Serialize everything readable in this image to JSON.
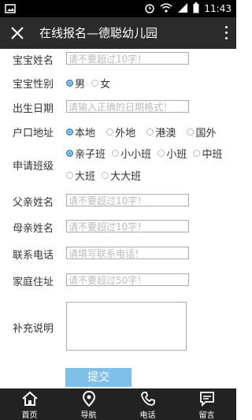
{
  "status_bar": {
    "time": "11:43"
  },
  "app_bar": {
    "title": "在线报名—德聪幼儿园"
  },
  "form": {
    "baby_name": {
      "label": "宝宝姓名",
      "placeholder": "请不要超过10字！"
    },
    "baby_gender": {
      "label": "宝宝性别",
      "options": [
        "男",
        "女"
      ],
      "selected": "男"
    },
    "birth_date": {
      "label": "出生日期",
      "placeholder": "请输入正确的日期格式！"
    },
    "household": {
      "label": "户口地址",
      "options": [
        "本地",
        "外地",
        "港澳",
        "国外"
      ],
      "selected": "本地"
    },
    "class": {
      "label": "申请班级",
      "options": [
        "亲子班",
        "小小班",
        "小班",
        "中班",
        "大班",
        "大大班"
      ],
      "selected": "亲子班"
    },
    "father_name": {
      "label": "父亲姓名",
      "placeholder": "请不要超过10字！"
    },
    "mother_name": {
      "label": "母亲姓名",
      "placeholder": "请不要超过10字！"
    },
    "phone": {
      "label": "联系电话",
      "placeholder": "请填写联系电话！"
    },
    "address": {
      "label": "家庭住址",
      "placeholder": "请不要超过50字！"
    },
    "notes": {
      "label": "补充说明"
    },
    "submit_label": "提交"
  },
  "tab_bar": {
    "items": [
      {
        "label": "首页",
        "icon": "home-icon"
      },
      {
        "label": "导航",
        "icon": "location-pin-icon"
      },
      {
        "label": "电话",
        "icon": "phone-icon"
      },
      {
        "label": "留言",
        "icon": "message-icon"
      }
    ]
  },
  "colors": {
    "accent": "#3c8dde",
    "submit_bg": "#7fc0e8",
    "app_bar_bg": "#2b2b2b",
    "tab_bar_bg": "#222222"
  }
}
